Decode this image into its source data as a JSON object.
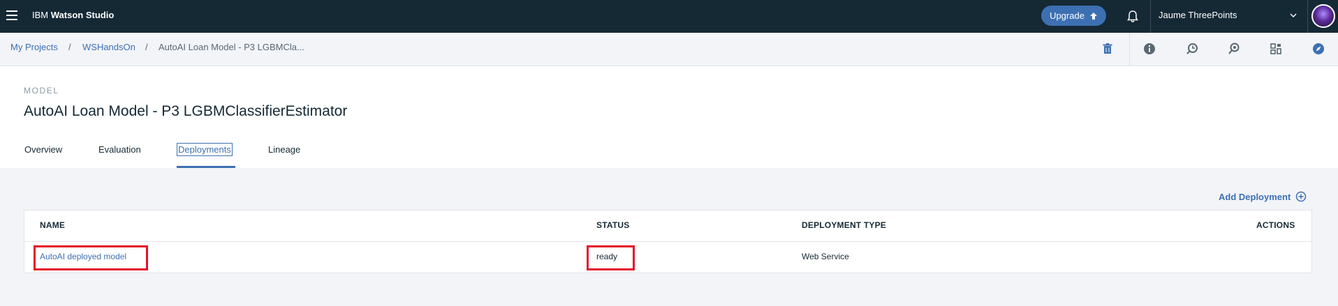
{
  "topbar": {
    "brand_prefix": "IBM",
    "brand_name": "Watson Studio",
    "upgrade_label": "Upgrade",
    "user_name": "Jaume ThreePoints"
  },
  "breadcrumb": {
    "items": [
      "My Projects",
      "WSHandsOn",
      "AutoAI Loan Model - P3 LGBMCla..."
    ],
    "separator": "/"
  },
  "toolbar": {
    "icons": [
      "trash-icon",
      "info-icon",
      "history-icon",
      "find-icon",
      "grid-icon",
      "compass-icon"
    ]
  },
  "header": {
    "kind": "MODEL",
    "title": "AutoAI Loan Model - P3 LGBMClassifierEstimator",
    "tabs": [
      "Overview",
      "Evaluation",
      "Deployments",
      "Lineage"
    ],
    "active_tab": "Deployments"
  },
  "deployments": {
    "add_label": "Add Deployment",
    "columns": [
      "NAME",
      "STATUS",
      "DEPLOYMENT TYPE",
      "ACTIONS"
    ],
    "rows": [
      {
        "name": "AutoAI deployed model",
        "status": "ready",
        "type": "Web Service"
      }
    ]
  },
  "colors": {
    "topbar_bg": "#152935",
    "accent": "#3d70b2",
    "highlight": "#e3122a"
  }
}
